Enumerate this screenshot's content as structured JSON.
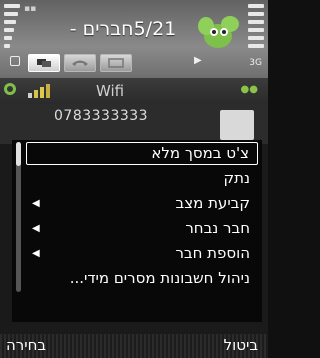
{
  "status": {
    "network_icon": "network-3g-icon",
    "network_label": "3G",
    "signal_icon": "signal-bars-icon",
    "battery_icon": "battery-bars-icon"
  },
  "header": {
    "title": "5/21חברים -",
    "logo_icon": "green-character-logo-icon"
  },
  "tabs": [
    {
      "icon": "chat-bubbles-icon",
      "active": true
    },
    {
      "icon": "phone-icon",
      "active": false
    },
    {
      "icon": "screen-icon",
      "active": false
    }
  ],
  "list": {
    "group_label": "Wifi",
    "contact_number": "0783333333"
  },
  "menu": {
    "items": [
      {
        "label": "צ'ט במסך מלא",
        "has_submenu": false,
        "selected": true
      },
      {
        "label": "נתק",
        "has_submenu": false,
        "selected": false
      },
      {
        "label": "קביעת מצב",
        "has_submenu": true,
        "selected": false
      },
      {
        "label": "חבר נבחר",
        "has_submenu": true,
        "selected": false
      },
      {
        "label": "הוספת חבר",
        "has_submenu": true,
        "selected": false
      },
      {
        "label": "ניהול חשבונות מסרים מידי...",
        "has_submenu": false,
        "selected": false
      }
    ]
  },
  "softkeys": {
    "left": "בחירה",
    "right": "ביטול"
  },
  "colors": {
    "accent_green": "#7ec04a",
    "menu_bg": "#080808"
  }
}
